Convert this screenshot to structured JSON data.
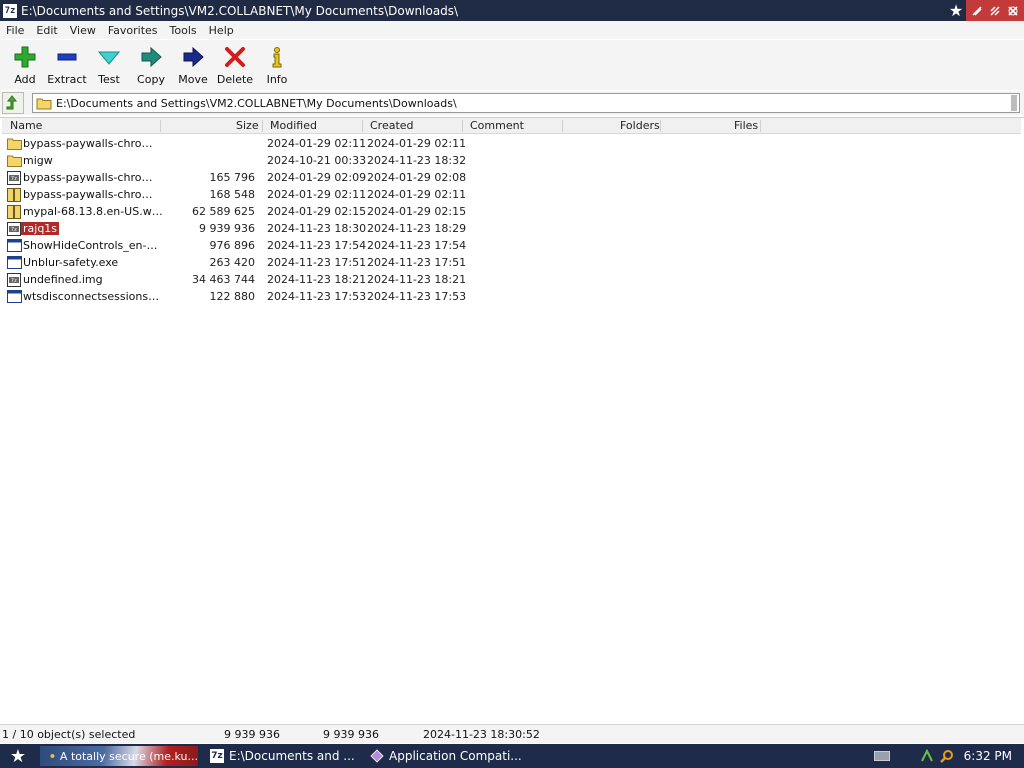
{
  "window": {
    "title": "E:\\Documents and Settings\\VM2.COLLABNET\\My Documents\\Downloads\\",
    "app_icon_text": "7z"
  },
  "menu": [
    "File",
    "Edit",
    "View",
    "Favorites",
    "Tools",
    "Help"
  ],
  "toolbar": [
    {
      "label": "Add",
      "icon": "plus-icon"
    },
    {
      "label": "Extract",
      "icon": "minus-icon"
    },
    {
      "label": "Test",
      "icon": "check-icon"
    },
    {
      "label": "Copy",
      "icon": "copy-arrow-icon"
    },
    {
      "label": "Move",
      "icon": "move-arrow-icon"
    },
    {
      "label": "Delete",
      "icon": "delete-x-icon"
    },
    {
      "label": "Info",
      "icon": "info-icon"
    }
  ],
  "address": {
    "path": "E:\\Documents and Settings\\VM2.COLLABNET\\My Documents\\Downloads\\"
  },
  "columns": [
    "Name",
    "Size",
    "Modified",
    "Created",
    "Comment",
    "Folders",
    "Files"
  ],
  "rows": [
    {
      "name": "bypass-paywalls-chrome-...",
      "size": "",
      "modified": "2024-01-29 02:11",
      "created": "2024-01-29 02:11",
      "icon": "folder"
    },
    {
      "name": "migw",
      "size": "",
      "modified": "2024-10-21 00:33",
      "created": "2024-11-23 18:32",
      "icon": "folder"
    },
    {
      "name": "bypass-paywalls-chrome-...",
      "size": "165 796",
      "modified": "2024-01-29 02:09",
      "created": "2024-01-29 02:08",
      "icon": "archive"
    },
    {
      "name": "bypass-paywalls-chrome-...",
      "size": "168 548",
      "modified": "2024-01-29 02:11",
      "created": "2024-01-29 02:11",
      "icon": "zip"
    },
    {
      "name": "mypal-68.13.8.en-US.win...",
      "size": "62 589 625",
      "modified": "2024-01-29 02:15",
      "created": "2024-01-29 02:15",
      "icon": "zip"
    },
    {
      "name": "rajq1s",
      "size": "9 939 936",
      "modified": "2024-11-23 18:30",
      "created": "2024-11-23 18:29",
      "icon": "archive",
      "selected": true
    },
    {
      "name": "ShowHideControls_en-us....",
      "size": "976 896",
      "modified": "2024-11-23 17:54",
      "created": "2024-11-23 17:54",
      "icon": "exe"
    },
    {
      "name": "Unblur-safety.exe",
      "size": "263 420",
      "modified": "2024-11-23 17:51",
      "created": "2024-11-23 17:51",
      "icon": "exe"
    },
    {
      "name": "undefined.img",
      "size": "34 463 744",
      "modified": "2024-11-23 18:21",
      "created": "2024-11-23 18:21",
      "icon": "archive"
    },
    {
      "name": "wtsdisconnectsessionspa...",
      "size": "122 880",
      "modified": "2024-11-23 17:53",
      "created": "2024-11-23 17:53",
      "icon": "exe"
    }
  ],
  "status": {
    "selection": "1 / 10 object(s) selected",
    "size1": "9 939 936",
    "size2": "9 939 936",
    "modified": "2024-11-23 18:30:52"
  },
  "taskbar": {
    "task1": "A totally secure (me.ku...",
    "task2": "E:\\Documents and ...",
    "task2_icon_text": "7z",
    "task3": "Application Compati...",
    "clock": "6:32 PM"
  }
}
